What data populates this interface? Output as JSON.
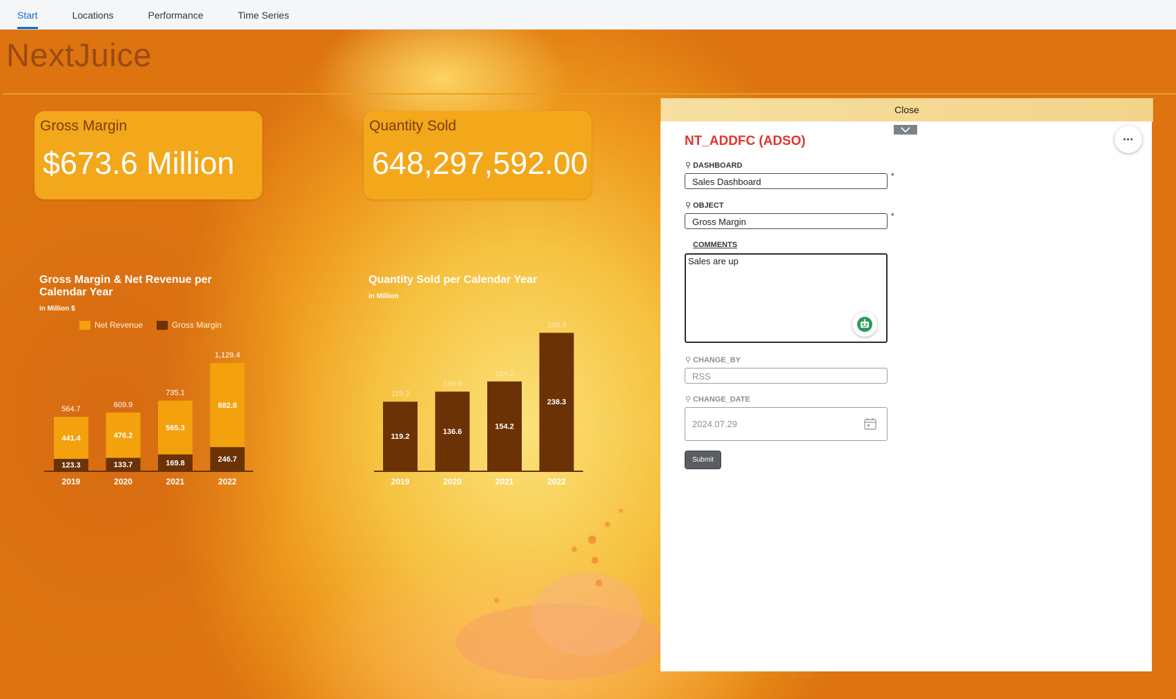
{
  "nav": {
    "tabs": [
      {
        "label": "Start",
        "active": true
      },
      {
        "label": "Locations",
        "active": false
      },
      {
        "label": "Performance",
        "active": false
      },
      {
        "label": "Time Series",
        "active": false
      }
    ]
  },
  "brand": {
    "title": "NextJuice"
  },
  "kpis": {
    "gross_margin": {
      "label": "Gross Margin",
      "value": "$673.6 Million"
    },
    "quantity_sold": {
      "label": "Quantity Sold",
      "value": "648,297,592.00"
    }
  },
  "colors": {
    "net_revenue": "#f3a10c",
    "gross_margin": "#6b3205",
    "quantity": "#6b3205",
    "accent_red": "#e0352b"
  },
  "chart_data": [
    {
      "type": "bar",
      "stacked": true,
      "title": "Gross Margin & Net Revenue per Calendar Year",
      "subtitle": "in Million $",
      "categories": [
        "2019",
        "2020",
        "2021",
        "2022"
      ],
      "series": [
        {
          "name": "Gross Margin",
          "values": [
            123.3,
            133.7,
            169.8,
            246.7
          ]
        },
        {
          "name": "Net Revenue",
          "values": [
            441.4,
            476.2,
            565.3,
            882.8
          ]
        }
      ],
      "totals": [
        "564.7",
        "609.9",
        "735.1",
        "1,129.4"
      ],
      "segment_labels": {
        "gross_margin": [
          "123.3",
          "133.7",
          "169.8",
          "246.7"
        ],
        "net_revenue": [
          "441.4",
          "476.2",
          "565.3",
          "882.8"
        ]
      },
      "legend": [
        "Net Revenue",
        "Gross Margin"
      ],
      "legend_position": "top",
      "grid": false
    },
    {
      "type": "bar",
      "title": "Quantity Sold per Calendar Year",
      "subtitle": "in Million",
      "categories": [
        "2019",
        "2020",
        "2021",
        "2022"
      ],
      "values": [
        119.2,
        136.6,
        154.2,
        238.3
      ],
      "labels": [
        "119.2",
        "136.6",
        "154.2",
        "238.3"
      ],
      "grid": false
    }
  ],
  "panel": {
    "close_label": "Close",
    "title": "NT_ADDFC (ADSO)",
    "more_label": "•••",
    "fields": {
      "dashboard": {
        "label": "DASHBOARD",
        "value": "Sales Dashboard",
        "required": "*"
      },
      "object": {
        "label": "OBJECT",
        "value": "Gross Margin",
        "required": "*"
      },
      "comments": {
        "label": "COMMENTS",
        "value": "Sales are up"
      },
      "change_by": {
        "label": "CHANGE_BY",
        "value": "RSS"
      },
      "change_date": {
        "label": "CHANGE_DATE",
        "value": "2024.07.29"
      }
    },
    "submit_label": "Submit"
  }
}
